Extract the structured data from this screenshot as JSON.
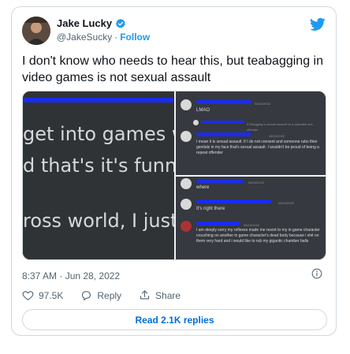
{
  "author": {
    "name": "Jake Lucky",
    "handle": "@JakeSucky",
    "follow_label": "Follow",
    "separator": "·"
  },
  "tweet": {
    "text": "I don't know who needs to hear this, but teabagging in video games is not sexual assault",
    "timestamp": "8:37 AM · Jun 28, 2022"
  },
  "media": {
    "left_panel_lines": [
      "get into games wh",
      "d that's it's funny,",
      "ross world, I just w"
    ],
    "chat_top": {
      "msg1_time": "06/24/2022",
      "msg1_text": "LMAO",
      "reply_text": "If Ebagging is sexual assault im a repeated sex offender",
      "msg2_time": "06/24/2022",
      "msg2_text": "I mean it is sexual assault. If I do not consent and someone rubs thier genitals in my face that's sexual assault. I wouldn't be proud of being a repeat offender"
    },
    "chat_bottom": {
      "msg1_time": "06/24/2022",
      "msg1_text": "where",
      "msg2_time": "06/24/2022",
      "msg2_text": "It's right there",
      "msg3_time": "06/24/2022",
      "msg3_text": "I am deeply sorry my reflexes made me resort to my in game character crouching on another in game character's dead body because i shit on them very hard and i would like to rub my gigantic chamber balls"
    }
  },
  "actions": {
    "likes": "97.5K",
    "reply_label": "Reply",
    "share_label": "Share",
    "read_replies_label": "Read 2.1K replies"
  },
  "colors": {
    "brand_blue": "#1d9bf0",
    "link_blue": "#006fd6",
    "muted": "#536471",
    "scribble": "#1a2cf0"
  }
}
